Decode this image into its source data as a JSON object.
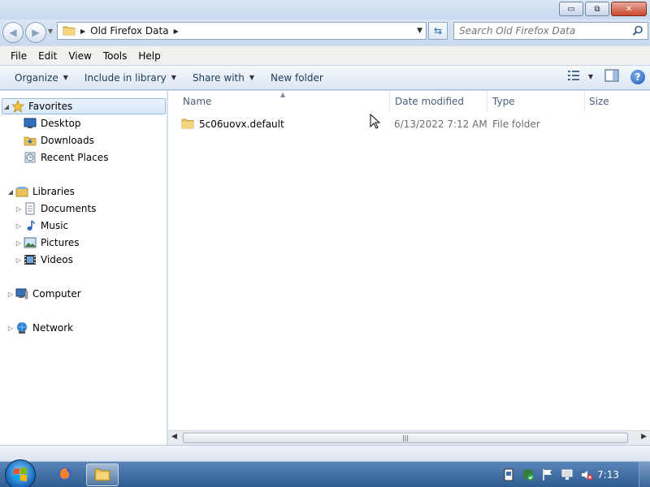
{
  "window": {
    "controls": {
      "minimize": "▭",
      "maximize": "⧉",
      "close": "✕"
    }
  },
  "address": {
    "crumbs": [
      "Old Firefox Data"
    ],
    "search_placeholder": "Search Old Firefox Data"
  },
  "menu": [
    "File",
    "Edit",
    "View",
    "Tools",
    "Help"
  ],
  "commands": {
    "organize": "Organize",
    "include_in_library": "Include in library",
    "share_with": "Share with",
    "new_folder": "New folder"
  },
  "nav": {
    "favorites": "Favorites",
    "desktop": "Desktop",
    "downloads": "Downloads",
    "recent_places": "Recent Places",
    "libraries": "Libraries",
    "documents": "Documents",
    "music": "Music",
    "pictures": "Pictures",
    "videos": "Videos",
    "computer": "Computer",
    "network": "Network"
  },
  "columns": {
    "name": "Name",
    "date_modified": "Date modified",
    "type": "Type",
    "size": "Size"
  },
  "files": [
    {
      "name": "5c06uovx.default",
      "date_modified": "6/13/2022 7:12 AM",
      "type": "File folder"
    }
  ],
  "taskbar": {
    "clock": "7:13"
  },
  "colors": {
    "accent": "#1e395b",
    "selection": "#d7e8fc",
    "taskbar": "#2d5c92",
    "folder": "#e8c35a"
  }
}
